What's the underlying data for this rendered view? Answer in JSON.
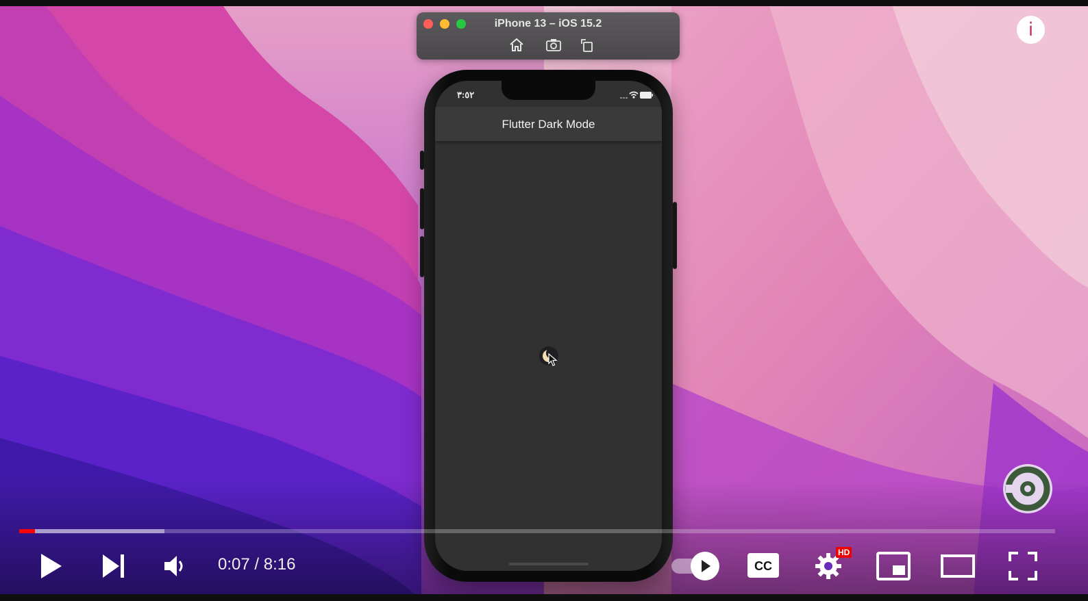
{
  "simulator": {
    "title": "iPhone 13 – iOS 15.2",
    "toolbar": [
      "home-icon",
      "screenshot-icon",
      "rotate-icon"
    ]
  },
  "phone": {
    "status_time": "٣:٥٢",
    "app_title": "Flutter Dark Mode",
    "theme_toggle_icon": "moon-icon"
  },
  "player": {
    "info_label": "i",
    "progress_played_fraction": 0.015,
    "progress_buffered_fraction": 0.14,
    "time": {
      "current": "0:07",
      "separator": "/",
      "duration": "8:16"
    },
    "autoplay_on": true,
    "hd_badge": "HD",
    "cc_label": "CC",
    "colors": {
      "progress_played": "#ff0000",
      "hd_badge": "#ee0000",
      "info_icon": "#c2306b"
    }
  }
}
